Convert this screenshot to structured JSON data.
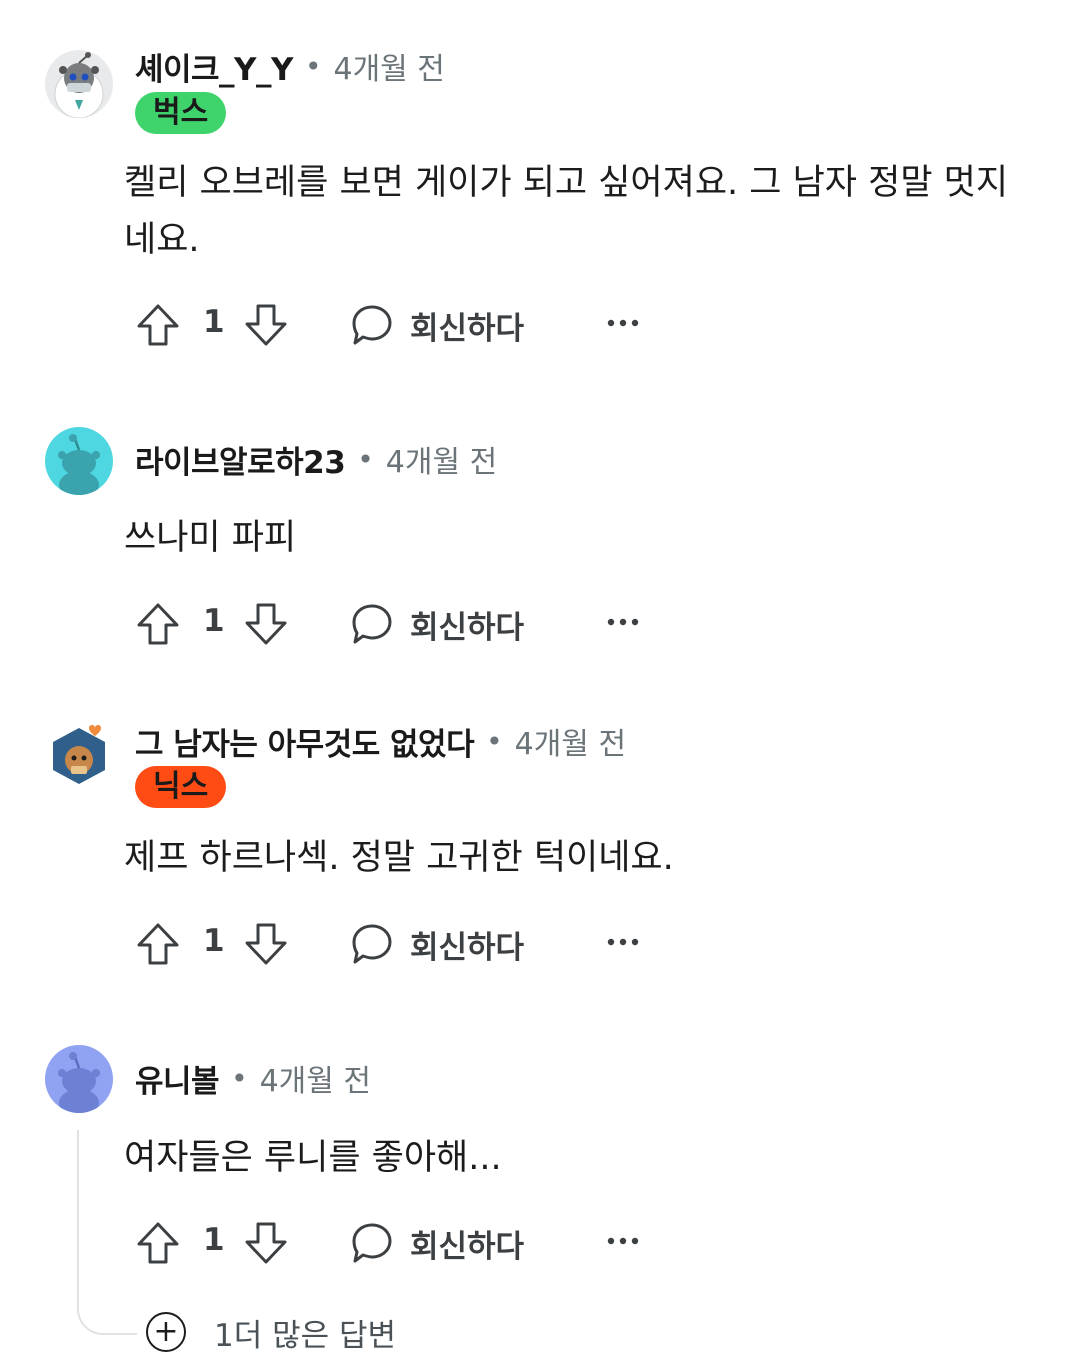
{
  "comments": [
    {
      "username": "셰이크_Y_Y",
      "time": "4개월 전",
      "flair": "벅스",
      "flair_color": "#3fd36c",
      "avatar": "snoo-masked-icon",
      "body": "켈리 오브레를 보면 게이가 되고 싶어져요. 그 남자 정말 멋지네요.",
      "votes": "1",
      "reply": "회신하다"
    },
    {
      "username": "라이브알로하23",
      "time": "4개월 전",
      "flair": "",
      "avatar": "snoo-teal-icon",
      "body": "쓰나미 파피",
      "votes": "1",
      "reply": "회신하다"
    },
    {
      "username": "그 남자는 아무것도 없었다",
      "time": "4개월 전",
      "flair": "닉스",
      "flair_color": "#ff4c14",
      "avatar": "snoo-hexagon-icon",
      "body": "제프 하르나섹. 정말 고귀한 턱이네요.",
      "votes": "1",
      "reply": "회신하다"
    },
    {
      "username": "유니볼",
      "time": "4개월 전",
      "flair": "",
      "avatar": "snoo-blue-icon",
      "body": "여자들은 루니를 좋아해...",
      "votes": "1",
      "reply": "회신하다"
    }
  ],
  "more_replies": "1더 많은 답변",
  "separator": "•",
  "colors": {
    "text": "#1c1c1c",
    "meta": "#6b7479",
    "actions": "#3c4043",
    "thread_line": "#e0e3e5"
  }
}
